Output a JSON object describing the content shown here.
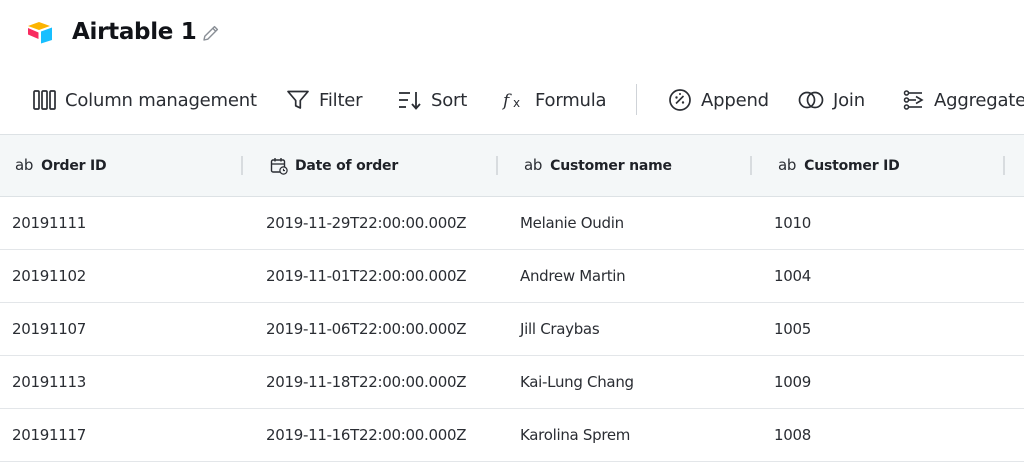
{
  "header": {
    "title": "Airtable 1",
    "logo_icon": "airtable-logo",
    "edit_icon": "pencil-icon"
  },
  "toolbar": {
    "items": [
      {
        "label": "Column management",
        "icon": "columns-icon"
      },
      {
        "label": "Filter",
        "icon": "filter-icon"
      },
      {
        "label": "Sort",
        "icon": "sort-icon"
      },
      {
        "label": "Formula",
        "icon": "formula-icon"
      },
      {
        "label": "Append",
        "icon": "append-icon"
      },
      {
        "label": "Join",
        "icon": "join-icon"
      },
      {
        "label": "Aggregate",
        "icon": "aggregate-icon"
      }
    ]
  },
  "table": {
    "columns": [
      {
        "label": "Order ID",
        "type_icon": "ab"
      },
      {
        "label": "Date of order",
        "type_icon": "calendar-icon"
      },
      {
        "label": "Customer name",
        "type_icon": "ab"
      },
      {
        "label": "Customer ID",
        "type_icon": "ab"
      }
    ],
    "rows": [
      {
        "order_id": "20191111",
        "date": "2019-11-29T22:00:00.000Z",
        "customer_name": "Melanie Oudin",
        "customer_id": "1010"
      },
      {
        "order_id": "20191102",
        "date": "2019-11-01T22:00:00.000Z",
        "customer_name": "Andrew Martin",
        "customer_id": "1004"
      },
      {
        "order_id": "20191107",
        "date": "2019-11-06T22:00:00.000Z",
        "customer_name": "Jill Craybas",
        "customer_id": "1005"
      },
      {
        "order_id": "20191113",
        "date": "2019-11-18T22:00:00.000Z",
        "customer_name": "Kai-Lung Chang",
        "customer_id": "1009"
      },
      {
        "order_id": "20191117",
        "date": "2019-11-16T22:00:00.000Z",
        "customer_name": "Karolina Sprem",
        "customer_id": "1008"
      }
    ]
  },
  "colors": {
    "header_bg": "#f4f7f8",
    "text": "#2a2d33",
    "logo_yellow": "#fcb400",
    "logo_blue": "#18bfff",
    "logo_red": "#f82b60"
  }
}
